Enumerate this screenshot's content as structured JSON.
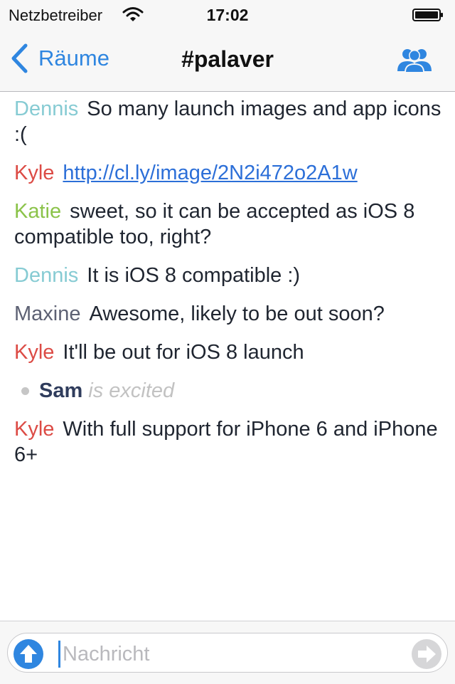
{
  "status_bar": {
    "carrier": "Netzbetreiber",
    "time": "17:02"
  },
  "nav": {
    "back_label": "Räume",
    "title": "#palaver",
    "members_icon": "people-icon"
  },
  "colors": {
    "accent": "#2f86e0",
    "link": "#2c6fd8",
    "nick_dennis": "#86cbd3",
    "nick_kyle": "#dc4b45",
    "nick_katie": "#8bc34a",
    "nick_maxine": "#5d6173",
    "nick_sam": "#2f3c5c"
  },
  "messages": [
    {
      "nick": "Dennis",
      "text": "So many launch images and app icons :("
    },
    {
      "nick": "Kyle",
      "link": "http://cl.ly/image/2N2i472o2A1w"
    },
    {
      "nick": "Katie",
      "text": "sweet, so it can be accepted as iOS 8 compatible too, right?"
    },
    {
      "nick": "Dennis",
      "text": "It is iOS 8 compatible :)"
    },
    {
      "nick": "Maxine",
      "text": "Awesome, likely to be out soon?"
    },
    {
      "nick": "Kyle",
      "text": "It'll be out for iOS 8 launch"
    },
    {
      "action_nick": "Sam",
      "action_text": "is excited"
    },
    {
      "nick": "Kyle",
      "text": "With full support for iPhone 6 and iPhone 6+"
    }
  ],
  "composer": {
    "placeholder": "Nachricht",
    "upload_icon": "upload-arrow-icon",
    "send_icon": "send-arrow-icon"
  }
}
